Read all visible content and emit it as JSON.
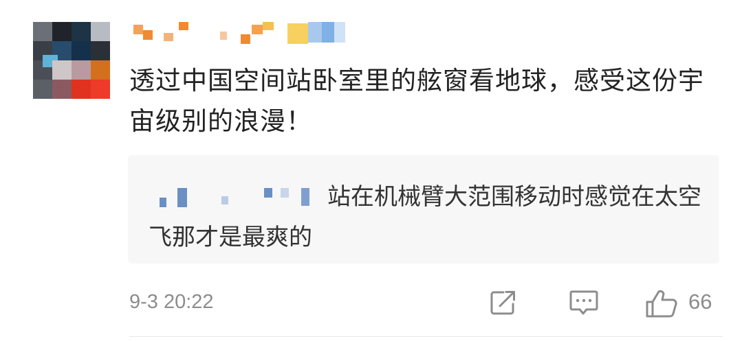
{
  "comment": {
    "text": "透过中国空间站卧室里的舷窗看地球，感受这份宇宙级别的浪漫！",
    "reply": {
      "text": "站在机械臂大范围移动时感觉在太空飞那才是最爽的"
    },
    "timestamp": "9-3 20:22",
    "like_count": "66"
  },
  "icons": {
    "share": "share-icon",
    "comment": "comment-icon",
    "like": "thumbs-up-icon"
  },
  "colors": {
    "text_primary": "#222222",
    "text_secondary": "#8c8c8c",
    "reply_background": "#f7f7f7"
  }
}
